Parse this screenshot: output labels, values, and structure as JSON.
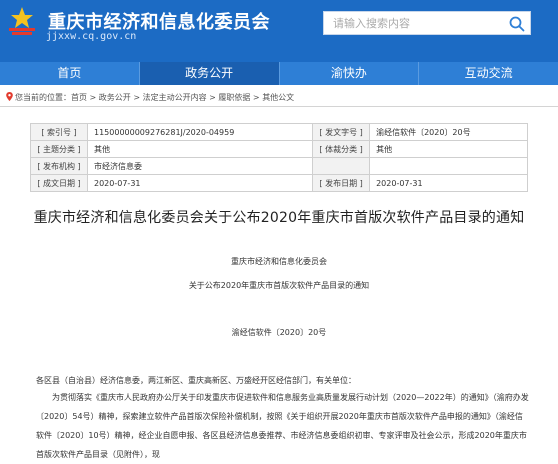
{
  "header": {
    "site_title": "重庆市经济和信息化委员会",
    "site_url": "jjxxw.cq.gov.cn",
    "search_placeholder": "请输入搜索内容"
  },
  "nav": {
    "items": [
      {
        "label": "首页"
      },
      {
        "label": "政务公开"
      },
      {
        "label": "渝快办"
      },
      {
        "label": "互动交流"
      }
    ]
  },
  "breadcrumb": {
    "prefix": "您当前的位置：",
    "items": [
      "首页",
      "政务公开",
      "法定主动公开内容",
      "履职依据",
      "其他公文"
    ],
    "separator": " > "
  },
  "info": {
    "rows": [
      [
        "[ 索引号 ]",
        "11500000009276281J/2020-04959",
        "[ 发文字号 ]",
        "渝经信软件〔2020〕20号"
      ],
      [
        "[ 主题分类 ]",
        "其他",
        "[ 体裁分类 ]",
        "其他"
      ],
      [
        "[ 发布机构 ]",
        "市经济信息委",
        "",
        ""
      ],
      [
        "[ 成文日期 ]",
        "2020-07-31",
        "[ 发布日期 ]",
        "2020-07-31"
      ]
    ]
  },
  "article": {
    "title": "重庆市经济和信息化委员会关于公布2020年重庆市首版次软件产品目录的通知",
    "issuer": "重庆市经济和信息化委员会",
    "subtitle": "关于公布2020年重庆市首版次软件产品目录的通知",
    "doc_number": "渝经信软件〔2020〕20号",
    "salutation": "各区县（自治县）经济信息委，两江新区、重庆高新区、万盛经开区经信部门，有关单位：",
    "body": "为贯彻落实《重庆市人民政府办公厅关于印发重庆市促进软件和信息服务业高质量发展行动计划（2020—2022年）的通知》（渝府办发〔2020〕54号）精神，探索建立软件产品首版次保险补偿机制，按照《关于组织开展2020年重庆市首版次软件产品申报的通知》（渝经信软件〔2020〕10号）精神，经企业自愿申报、各区县经济信息委推荐、市经济信息委组织初审、专家评审及社会公示，形成2020年重庆市首版次软件产品目录（见附件），现"
  }
}
